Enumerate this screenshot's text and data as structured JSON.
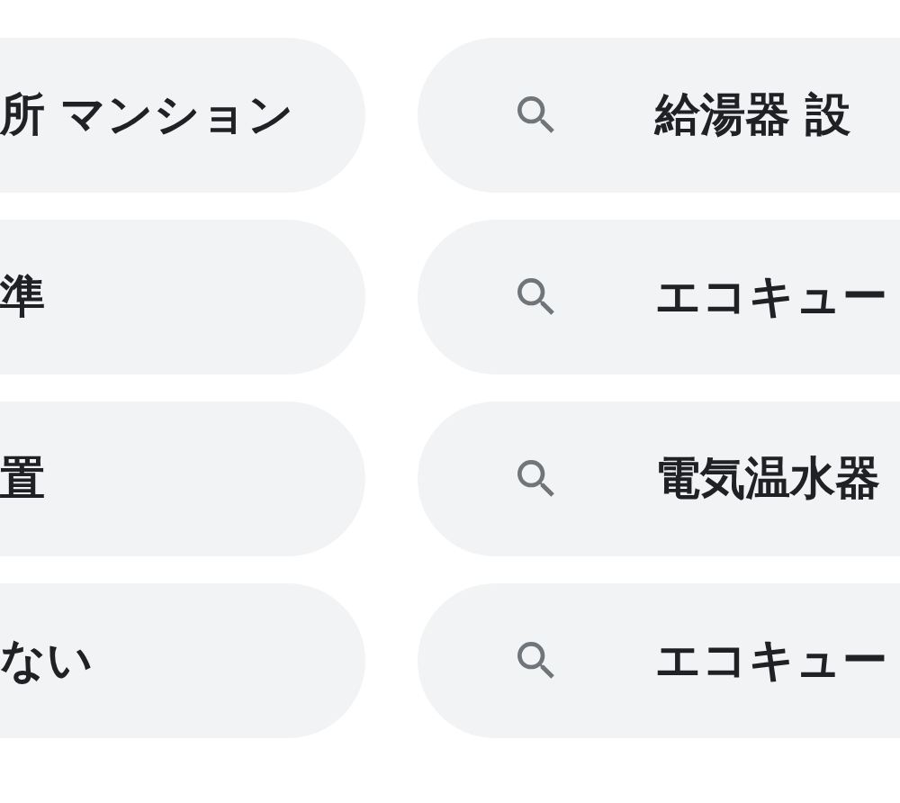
{
  "rows": [
    {
      "left": "所 マンション",
      "right": "給湯器 設"
    },
    {
      "left": "準",
      "right": "エコキュー"
    },
    {
      "left": "置",
      "right": "電気温水器"
    },
    {
      "left": "ない",
      "right": "エコキュー"
    }
  ]
}
